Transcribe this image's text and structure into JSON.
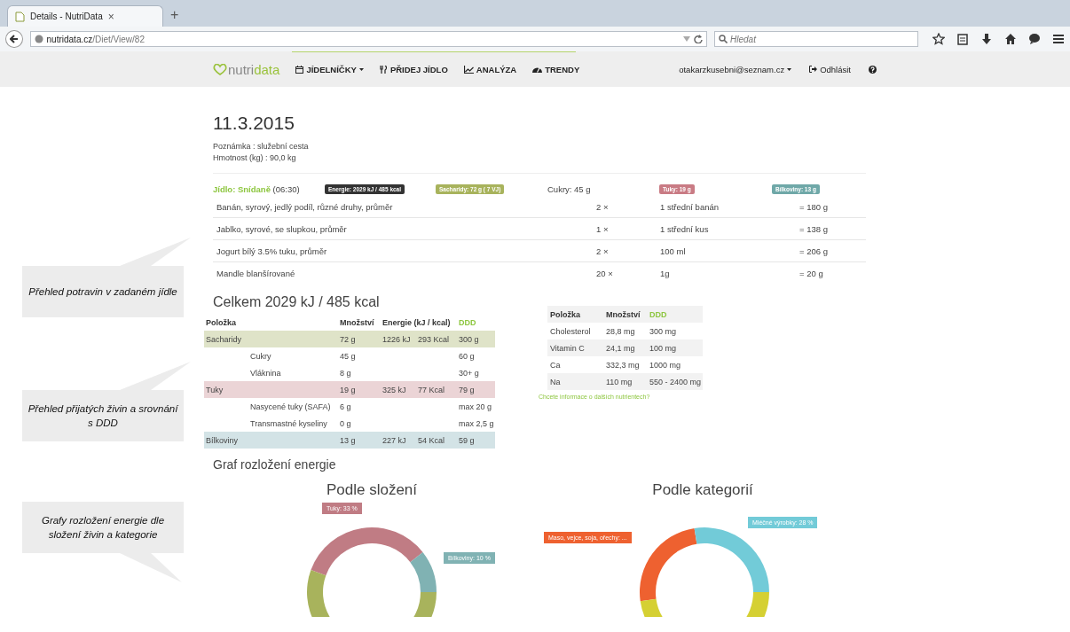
{
  "browser": {
    "tab_title": "Details - NutriData",
    "tab_close": "×",
    "new_tab": "+",
    "url": "**nutridata.cz**/Diet/View/82",
    "search_placeholder": "Hledat"
  },
  "nav": {
    "logo": [
      "nutri",
      "data"
    ],
    "items": [
      {
        "label": "JÍDELNÍČKY",
        "dropdown": true
      },
      {
        "label": "PŘIDEJ JÍDLO",
        "dropdown": false
      },
      {
        "label": "ANALÝZA",
        "dropdown": false
      },
      {
        "label": "TRENDY",
        "dropdown": false
      }
    ],
    "user": "otakarzkusebni@seznam.cz",
    "logout": "Odhlásit"
  },
  "day": {
    "date": "11.3.2015",
    "note": "Poznámka : služební cesta",
    "weight": "Hmotnost (kg) : 90,0 kg"
  },
  "meal": {
    "label": "Jídlo: Snídaně",
    "time": "(06:30)",
    "badges": [
      {
        "text": "Energie: 2029 kJ / 485 kcal",
        "kind": "badge",
        "color": "#333333"
      },
      {
        "text": "Sacharidy: 72 g ( 7 VJ)",
        "kind": "badge",
        "color": "#a8b35c"
      },
      {
        "text": "Cukry: 45 g",
        "kind": "plain"
      },
      {
        "text": "Tuky: 19 g",
        "kind": "badge",
        "color": "#c97b84"
      },
      {
        "text": "Bílkoviny: 13 g",
        "kind": "badge",
        "color": "#6fa8a8"
      }
    ],
    "foods": [
      {
        "name": "Banán, syrový, jedlý podíl, různé druhy, průměr",
        "count": "2 ×",
        "unit": "1 střední banán",
        "weight": "= 180 g"
      },
      {
        "name": "Jablko, syrové, se slupkou, průměr",
        "count": "1 ×",
        "unit": "1 střední kus",
        "weight": "= 138 g"
      },
      {
        "name": "Jogurt bílý 3.5% tuku, průměr",
        "count": "2 ×",
        "unit": "100 ml",
        "weight": "= 206 g"
      },
      {
        "name": "Mandle blanšírované",
        "count": "20 ×",
        "unit": "1g",
        "weight": "= 20 g"
      }
    ]
  },
  "totals": {
    "title": "Celkem 2029 kJ / 485 kcal",
    "columns": [
      {
        "label": "Položka",
        "accent": false
      },
      {
        "label": "Množství",
        "accent": false
      },
      {
        "label": "Energie (kJ / kcal)",
        "accent": false
      },
      {
        "label": "DDD",
        "accent": true
      }
    ],
    "rows": [
      {
        "kind": "main",
        "color": "#dfe3c8",
        "name": "Sacharidy",
        "amount": "72 g",
        "kj": "1226 kJ",
        "kcal": "293 Kcal",
        "ddd": "300 g"
      },
      {
        "kind": "sub",
        "name": "Cukry",
        "amount": "45 g",
        "ddd": "60 g"
      },
      {
        "kind": "sub",
        "name": "Vláknina",
        "amount": "8 g",
        "ddd": "30+ g"
      },
      {
        "kind": "main",
        "color": "#ebd4d6",
        "name": "Tuky",
        "amount": "19 g",
        "kj": "325 kJ",
        "kcal": "77 Kcal",
        "ddd": "79 g"
      },
      {
        "kind": "sub",
        "name": "Nasycené tuky (SAFA)",
        "amount": "6 g",
        "ddd": "max 20 g"
      },
      {
        "kind": "sub",
        "name": "Transmastné kyseliny",
        "amount": "0 g",
        "ddd": "max 2,5 g"
      },
      {
        "kind": "main",
        "color": "#d3e3e6",
        "name": "Bílkoviny",
        "amount": "13 g",
        "kj": "227 kJ",
        "kcal": "54 Kcal",
        "ddd": "59 g"
      }
    ]
  },
  "micros": {
    "columns": [
      {
        "label": "Položka",
        "accent": false
      },
      {
        "label": "Množství",
        "accent": false
      },
      {
        "label": "DDD",
        "accent": true
      }
    ],
    "rows": [
      {
        "name": "Cholesterol",
        "amount": "28,8 mg",
        "ddd": "300 mg"
      },
      {
        "name": "Vitamin C",
        "amount": "24,1 mg",
        "ddd": "100 mg"
      },
      {
        "name": "Ca",
        "amount": "332,3 mg",
        "ddd": "1000 mg"
      },
      {
        "name": "Na",
        "amount": "110 mg",
        "ddd": "550 - 2400 mg"
      }
    ],
    "link": "Chcete informace o dalších nutrientech?"
  },
  "energy": {
    "title": "Graf rozložení energie",
    "charts": [
      {
        "title": "Podle složení",
        "segments": [
          {
            "color": "#c07c84"
          },
          {
            "color": "#80b2b3"
          },
          {
            "color": "#a8b35c"
          }
        ],
        "labels": [
          {
            "text": "Tuky: 33 %",
            "color": "#c07c84"
          },
          {
            "text": "Bílkoviny: 10 %",
            "color": "#80b2b3"
          }
        ]
      },
      {
        "title": "Podle kategorií",
        "segments": [
          {
            "color": "#ee6130"
          },
          {
            "color": "#72cbd8"
          },
          {
            "color": "#d5d033"
          }
        ],
        "labels": [
          {
            "text": "Maso, vejce, soja, ořechy: ...",
            "color": "#ee6130"
          },
          {
            "text": "Mléčné výrobky: 28 %",
            "color": "#72cbd8"
          }
        ]
      }
    ]
  },
  "callouts": [
    {
      "text": "Přehled potravin v zadaném jídle"
    },
    {
      "text": "Přehled přijatých živin a srovnání s DDD"
    },
    {
      "text": "Grafy rozložení energie dle složení živin a kategorie"
    }
  ]
}
